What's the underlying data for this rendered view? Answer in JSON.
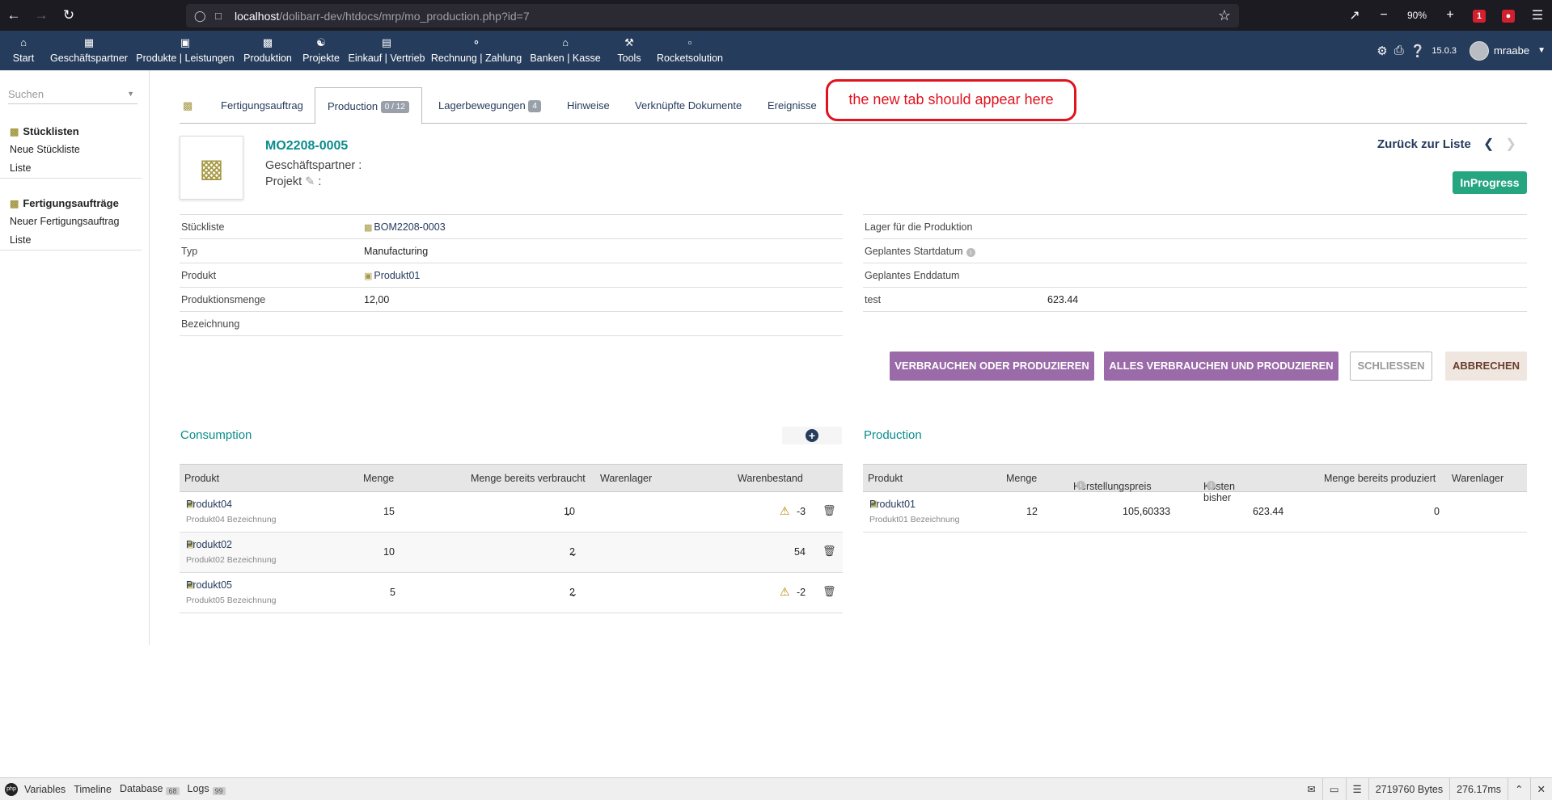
{
  "browser": {
    "url_host": "localhost",
    "url_path": "/dolibarr-dev/htdocs/mrp/mo_production.php?id=7",
    "zoom": "90%",
    "ext_badge": "1"
  },
  "topnav": {
    "items": [
      {
        "label": "Start",
        "icon": "home-icon"
      },
      {
        "label": "Geschäftspartner",
        "icon": "building-icon"
      },
      {
        "label": "Produkte | Leistungen",
        "icon": "cube-icon"
      },
      {
        "label": "Produktion",
        "icon": "cubes-icon"
      },
      {
        "label": "Projekte",
        "icon": "sitemap-icon"
      },
      {
        "label": "Einkauf | Vertrieb",
        "icon": "briefcase-icon"
      },
      {
        "label": "Rechnung | Zahlung",
        "icon": "coins-icon"
      },
      {
        "label": "Banken | Kasse",
        "icon": "bank-icon"
      },
      {
        "label": "Tools",
        "icon": "wrench-icon"
      },
      {
        "label": "Rocketsolution",
        "icon": "note-icon"
      }
    ],
    "version": "15.0.3",
    "username": "mraabe"
  },
  "sidebar": {
    "search_placeholder": "Suchen",
    "groups": [
      {
        "title": "Stücklisten",
        "links": [
          "Neue Stückliste",
          "Liste"
        ]
      },
      {
        "title": "Fertigungsaufträge",
        "links": [
          "Neuer Fertigungsauftrag",
          "Liste"
        ]
      }
    ]
  },
  "tabs": {
    "items": [
      {
        "label": "Fertigungsauftrag",
        "badge": ""
      },
      {
        "label": "Production",
        "badge": "0 / 12"
      },
      {
        "label": "Lagerbewegungen",
        "badge": "4"
      },
      {
        "label": "Hinweise",
        "badge": ""
      },
      {
        "label": "Verknüpfte Dokumente",
        "badge": ""
      },
      {
        "label": "Ereignisse",
        "badge": ""
      }
    ],
    "annotation": "the new tab should appear here"
  },
  "header": {
    "ref": "MO2208-0005",
    "thirdparty_label": "Geschäftspartner :",
    "project_label": "Projekt",
    "project_suffix": ":",
    "back_to_list": "Zurück zur Liste",
    "status": "InProgress"
  },
  "fields_left": [
    {
      "label": "Stückliste",
      "value": "BOM2208-0003"
    },
    {
      "label": "Typ",
      "value": "Manufacturing"
    },
    {
      "label": "Produkt",
      "value": "Produkt01"
    },
    {
      "label": "Produktionsmenge",
      "value": "12,00"
    },
    {
      "label": "Bezeichnung",
      "value": ""
    }
  ],
  "fields_right": [
    {
      "label": "Lager für die Produktion",
      "value": ""
    },
    {
      "label": "Geplantes Startdatum",
      "value": ""
    },
    {
      "label": "Geplantes Enddatum",
      "value": ""
    },
    {
      "label": "test",
      "value": "623.44"
    }
  ],
  "actions": {
    "consume_or_produce": "VERBRAUCHEN ODER PRODUZIEREN",
    "consume_all": "ALLES VERBRAUCHEN UND PRODUZIEREN",
    "close": "SCHLIESSEN",
    "cancel": "ABBRECHEN"
  },
  "consumption": {
    "title": "Consumption",
    "headers": [
      "Produkt",
      "Menge",
      "Menge bereits verbraucht",
      "Warenlager",
      "Warenbestand"
    ],
    "rows": [
      {
        "product": "Produkt04",
        "desc": "Produkt04 Bezeichnung",
        "qty": "15",
        "consumed": "10",
        "warehouse": "",
        "stock": "-3",
        "warn": true
      },
      {
        "product": "Produkt02",
        "desc": "Produkt02 Bezeichnung",
        "qty": "10",
        "consumed": "2",
        "warehouse": "",
        "stock": "54",
        "warn": false
      },
      {
        "product": "Produkt05",
        "desc": "Produkt05 Bezeichnung",
        "qty": "5",
        "consumed": "2",
        "warehouse": "",
        "stock": "-2",
        "warn": true
      }
    ]
  },
  "production": {
    "title": "Production",
    "headers": [
      "Produkt",
      "Menge",
      "Herstellungspreis",
      "Kosten bisher",
      "Menge bereits produziert",
      "Warenlager"
    ],
    "rows": [
      {
        "product": "Produkt01",
        "desc": "Produkt01 Bezeichnung",
        "qty": "12",
        "price": "105,60333",
        "cost": "623.44",
        "produced": "0",
        "warehouse": ""
      }
    ]
  },
  "debugbar": {
    "items": [
      {
        "label": "Variables",
        "badge": ""
      },
      {
        "label": "Timeline",
        "badge": ""
      },
      {
        "label": "Database",
        "badge": "68"
      },
      {
        "label": "Logs",
        "badge": "99"
      }
    ],
    "bytes": "2719760 Bytes",
    "time": "276.17ms"
  }
}
